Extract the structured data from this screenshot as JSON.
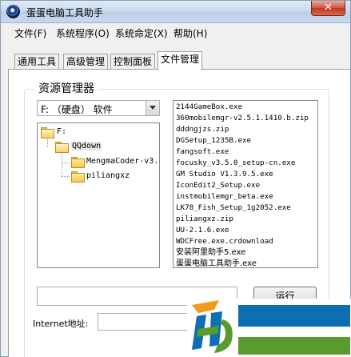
{
  "window": {
    "title": "蛋蛋电脑工具助手",
    "close_label": "✕"
  },
  "menu": {
    "items": [
      "文件(F)",
      "系统程序(O)",
      "系统命定(X)",
      "帮助(H)"
    ]
  },
  "tabs": [
    {
      "label": "通用工具",
      "active": false
    },
    {
      "label": "高级管理",
      "active": false
    },
    {
      "label": "控制面板",
      "active": false
    },
    {
      "label": "文件管理",
      "active": true
    }
  ],
  "explorer": {
    "group_title": "资源管理器",
    "drive_select": {
      "value": "F: （硬盘） 软件"
    },
    "tree": {
      "items": [
        {
          "label": "F:",
          "level": 0
        },
        {
          "label": "QQdown",
          "level": 1
        },
        {
          "label": "MengmaCoder-v3.",
          "level": 2
        },
        {
          "label": "piliangxz",
          "level": 2
        }
      ]
    },
    "files": [
      "2144GameBox.exe",
      "360mobilemgr-v2.5.1.1410.b.zip",
      "dddngjzs.zip",
      "DGSetup_1235B.exe",
      "fangsoft.exe",
      "focusky_v3.5.0_setup-cn.exe",
      "GM Studio V1.3.9.5.exe",
      "IconEdit2_Setup.exe",
      "instmobilemgr_beta.exe",
      "LK78_Fish_Setup_1g2052.exe",
      "piliangxz.zip",
      "UU-2.1.6.exe",
      "WDCFree.exe.crdownload",
      "安装阿里助手5.exe",
      "蛋蛋电脑工具助手.exe"
    ]
  },
  "command": {
    "input_value": "",
    "run_label": "运行"
  },
  "internet": {
    "label": "Internet地址:",
    "value": ""
  },
  "colors": {
    "watermark_blue": "#0d6eb3",
    "watermark_green": "#5a9a2e",
    "watermark_orange": "#f29a1f"
  }
}
